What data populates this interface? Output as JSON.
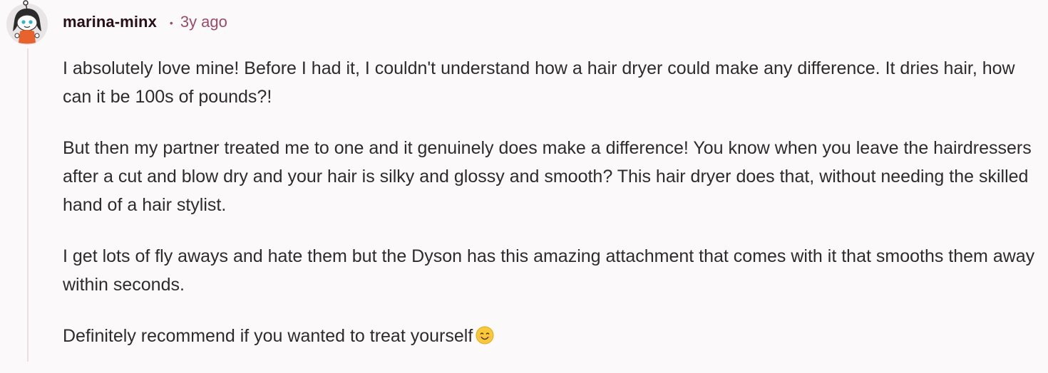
{
  "comment": {
    "username": "marina-minx",
    "separator": "•",
    "timestamp": "3y ago",
    "paragraphs": [
      "I absolutely love mine! Before I had it, I couldn't understand how a hair dryer could make any difference. It dries hair, how can it be 100s of pounds?!",
      "But then my partner treated me to one and it genuinely does make a difference! You know when you leave the hairdressers after a cut and blow dry and your hair is silky and glossy and smooth? This hair dryer does that, without needing the skilled hand of a hair stylist.",
      "I get lots of fly aways and hate them but the Dyson has this amazing attachment that comes with it that smooths them away within seconds.",
      "Definitely recommend if you wanted to treat yourself"
    ],
    "emoji_icon": "smiling-face-emoji",
    "avatar_icon": "reddit-snoo-avatar"
  },
  "colors": {
    "background": "#fcf9fa",
    "username": "#2a0e17",
    "meta": "#9c4a68",
    "text": "#2c2c2c",
    "thread_line": "#ecdde2"
  }
}
